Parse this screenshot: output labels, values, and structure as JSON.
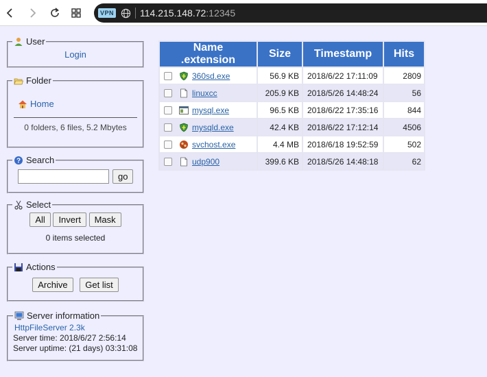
{
  "browser": {
    "vpn_badge": "VPN",
    "url_host": "114.215.148.72",
    "url_port": ":12345"
  },
  "user_panel": {
    "legend": "User",
    "login_link": "Login"
  },
  "folder_panel": {
    "legend": "Folder",
    "home_link": "Home",
    "summary": "0 folders, 6 files, 5.2 Mbytes"
  },
  "search_panel": {
    "legend": "Search",
    "query": "",
    "go_label": "go"
  },
  "select_panel": {
    "legend": "Select",
    "all_label": "All",
    "invert_label": "Invert",
    "mask_label": "Mask",
    "status": "0 items selected"
  },
  "actions_panel": {
    "legend": "Actions",
    "archive_label": "Archive",
    "getlist_label": "Get list"
  },
  "server_panel": {
    "legend": "Server information",
    "server_link": "HttpFileServer 2.3k",
    "server_time": "Server time: 2018/6/27 2:56:14",
    "server_uptime": "Server uptime: (21 days) 03:31:08"
  },
  "table": {
    "headers": {
      "name": "Name .extension",
      "size": "Size",
      "timestamp": "Timestamp",
      "hits": "Hits"
    },
    "rows": [
      {
        "name": "360sd.exe",
        "size": "56.9 KB",
        "timestamp": "2018/6/22 17:11:09",
        "hits": "2809",
        "icon": "shield-icon"
      },
      {
        "name": "linuxcc",
        "size": "205.9 KB",
        "timestamp": "2018/5/26 14:48:24",
        "hits": "56",
        "icon": "file-icon"
      },
      {
        "name": "mysql.exe",
        "size": "96.5 KB",
        "timestamp": "2018/6/22 17:35:16",
        "hits": "844",
        "icon": "window-icon"
      },
      {
        "name": "mysqld.exe",
        "size": "42.4 KB",
        "timestamp": "2018/6/22 17:12:14",
        "hits": "4506",
        "icon": "shield-icon"
      },
      {
        "name": "svchost.exe",
        "size": "4.4 MB",
        "timestamp": "2018/6/18 19:52:59",
        "hits": "502",
        "icon": "bug-icon"
      },
      {
        "name": "udp900",
        "size": "399.6 KB",
        "timestamp": "2018/5/26 14:48:18",
        "hits": "62",
        "icon": "file-icon"
      }
    ]
  }
}
